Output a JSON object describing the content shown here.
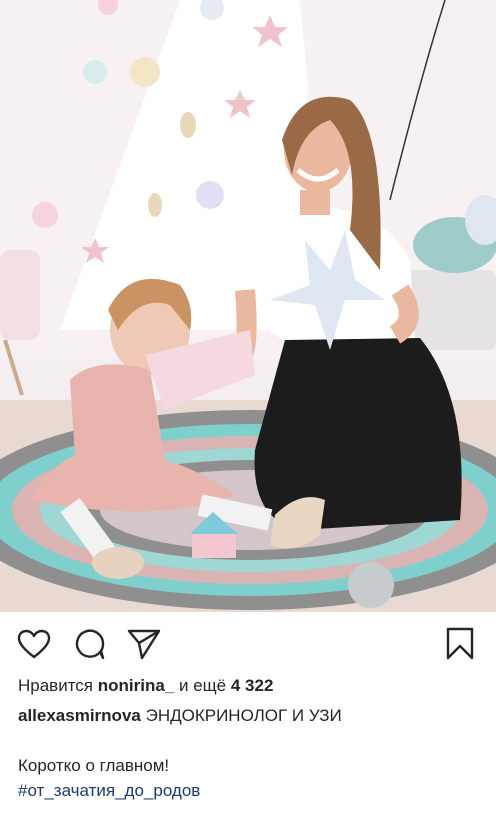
{
  "post": {
    "likes_prefix": "Нравится",
    "likes_user": "nonirina_",
    "likes_middle": "и ещё",
    "likes_count": "4 322",
    "author": "allexasmirnova",
    "author_bio": "ЭНДОКРИНОЛОГ И УЗИ",
    "caption": "Коротко о главном!",
    "hashtag": "#от_зачатия_до_родов"
  },
  "icons": {
    "like": "heart-outline-icon",
    "comment": "comment-bubble-icon",
    "share": "paper-plane-icon",
    "save": "bookmark-icon"
  },
  "colors": {
    "text": "#262626",
    "hashtag": "#1e3a6d"
  }
}
